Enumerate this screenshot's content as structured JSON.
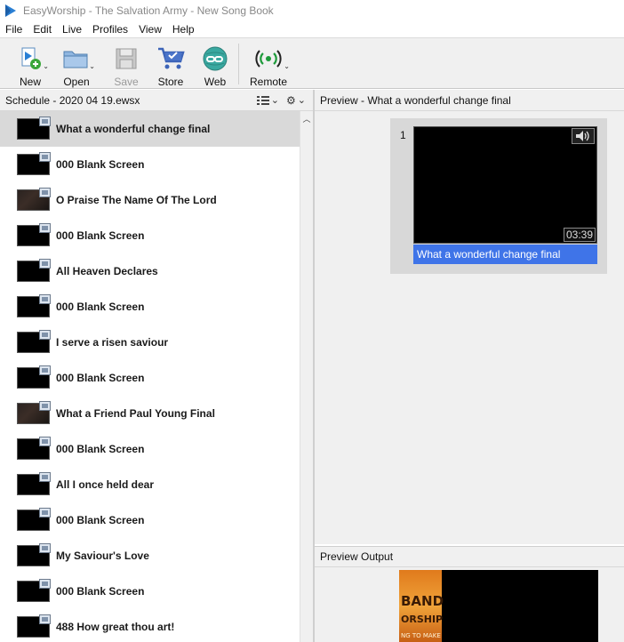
{
  "window": {
    "title": "EasyWorship - The Salvation Army - New Song Book"
  },
  "menu": [
    "File",
    "Edit",
    "Live",
    "Profiles",
    "View",
    "Help"
  ],
  "toolbar": {
    "new_label": "New",
    "open_label": "Open",
    "save_label": "Save",
    "store_label": "Store",
    "web_label": "Web",
    "remote_label": "Remote"
  },
  "schedule": {
    "title": "Schedule - 2020 04 19.ewsx",
    "items": [
      {
        "label": "What a wonderful change final",
        "selected": true
      },
      {
        "label": "000 Blank Screen"
      },
      {
        "label": "O Praise The Name Of The Lord"
      },
      {
        "label": "000 Blank Screen"
      },
      {
        "label": "All Heaven Declares"
      },
      {
        "label": "000 Blank Screen"
      },
      {
        "label": "I serve a risen saviour"
      },
      {
        "label": "000 Blank Screen"
      },
      {
        "label": "What a Friend Paul Young Final"
      },
      {
        "label": "000 Blank Screen"
      },
      {
        "label": "All I once held dear"
      },
      {
        "label": "000 Blank Screen"
      },
      {
        "label": "My Saviour's Love"
      },
      {
        "label": "000 Blank Screen"
      },
      {
        "label": "488 How great thou art!"
      }
    ]
  },
  "preview": {
    "title": "Preview - What a wonderful change final",
    "slide_number": "1",
    "duration": "03:39",
    "caption": "What a wonderful change final"
  },
  "output": {
    "title": "Preview Output",
    "poster_line1": "BAND",
    "poster_line2": "ORSHIP",
    "poster_line3": "NG TO MAKE"
  },
  "colors": {
    "accent": "#3f74e8",
    "panel": "#f0f0f0",
    "selected_row": "#d9d9d9"
  }
}
